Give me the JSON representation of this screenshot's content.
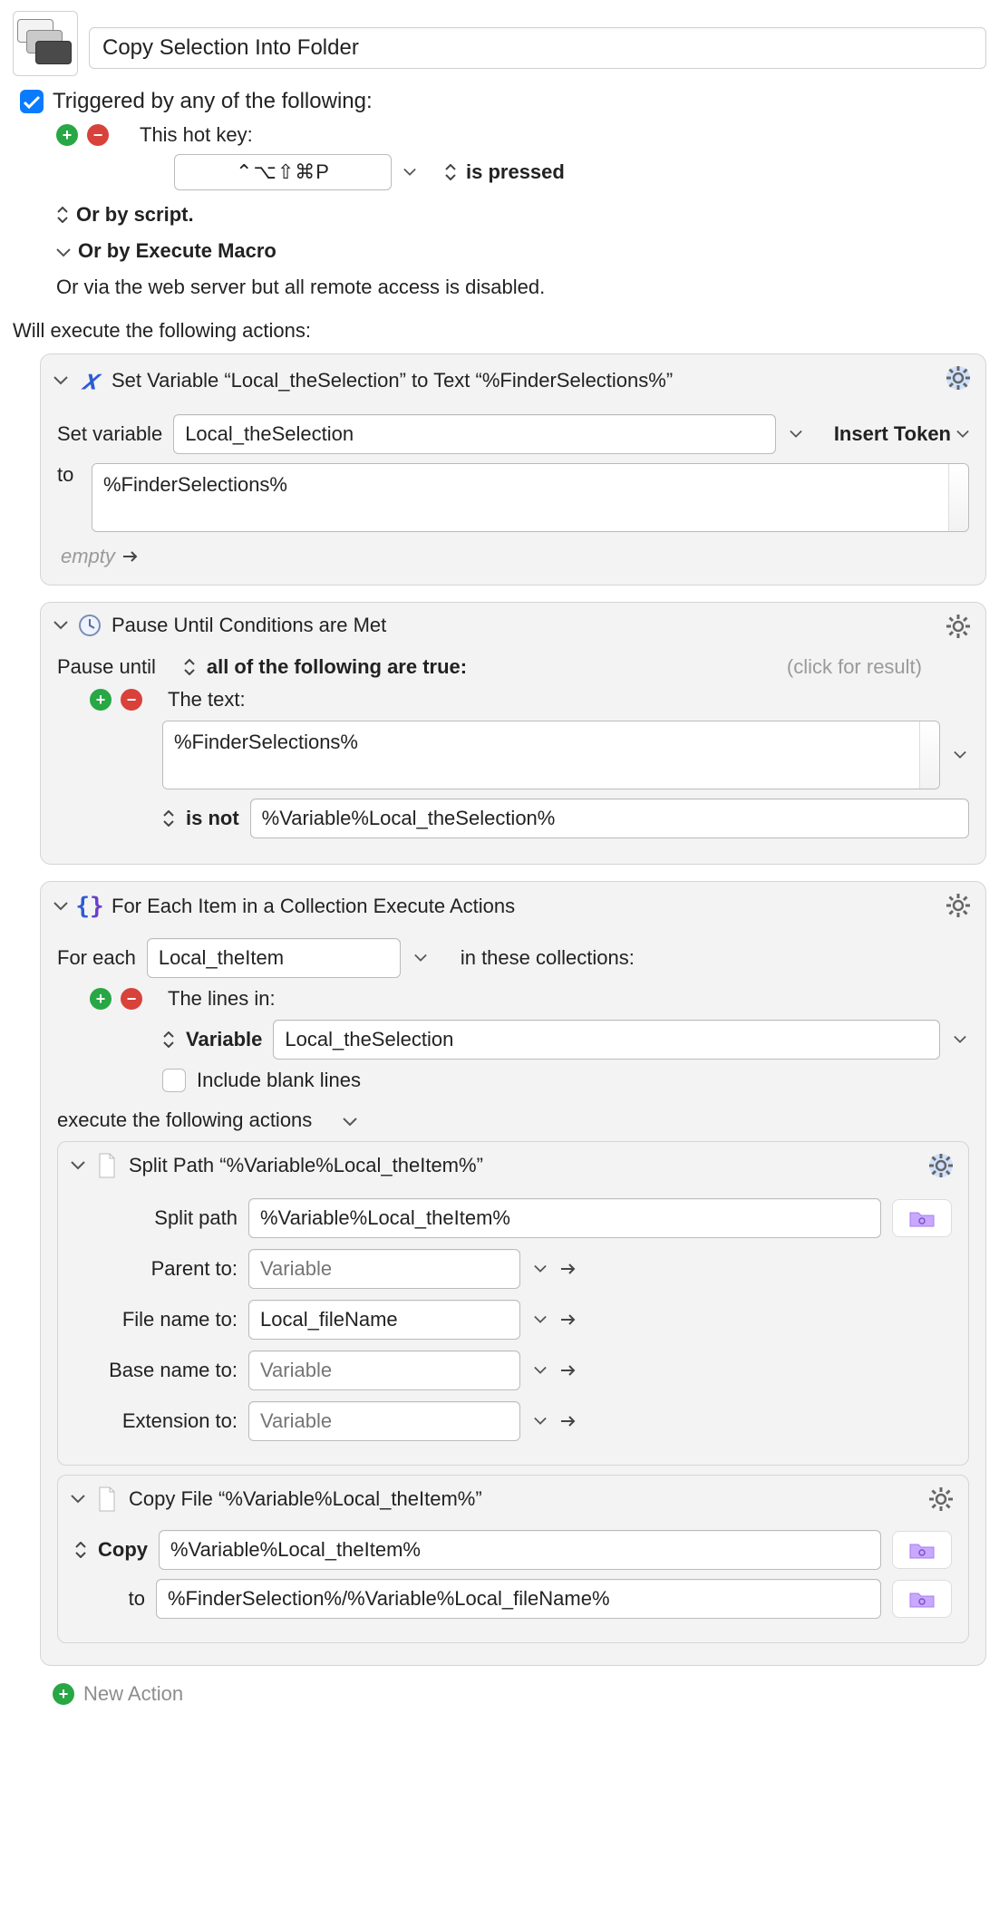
{
  "macro": {
    "title": "Copy Selection Into Folder",
    "triggered_label": "Triggered by any of the following:",
    "hotkey_label": "This hot key:",
    "hotkey_value": "⌃⌥⇧⌘P",
    "is_pressed": "is pressed",
    "or_script": "Or by script.",
    "or_execute_macro": "Or by Execute Macro",
    "or_web": "Or via the web server but all remote access is disabled.",
    "will_execute": "Will execute the following actions:"
  },
  "action1": {
    "title": "Set Variable “Local_theSelection” to Text “%FinderSelections%”",
    "set_variable_label": "Set variable",
    "variable_name": "Local_theSelection",
    "insert_token": "Insert Token",
    "to_label": "to",
    "to_value": "%FinderSelections%",
    "empty_hint": "empty"
  },
  "action2": {
    "title": "Pause Until Conditions are Met",
    "pause_until": "Pause until",
    "all_true": "all of the following are true:",
    "click_result": "(click for result)",
    "the_text": "The text:",
    "text_value": "%FinderSelections%",
    "is_not": "is not",
    "compare_value": "%Variable%Local_theSelection%"
  },
  "action3": {
    "title": "For Each Item in a Collection Execute Actions",
    "for_each": "For each",
    "item_var": "Local_theItem",
    "in_these": "in these collections:",
    "lines_in": "The lines in:",
    "variable_label": "Variable",
    "variable_value": "Local_theSelection",
    "include_blank": "Include blank lines",
    "execute_following": "execute the following actions"
  },
  "action3a": {
    "title": "Split Path “%Variable%Local_theItem%”",
    "split_path_label": "Split path",
    "split_path_value": "%Variable%Local_theItem%",
    "parent_label": "Parent to:",
    "filename_label": "File name to:",
    "filename_value": "Local_fileName",
    "basename_label": "Base name to:",
    "extension_label": "Extension to:",
    "var_placeholder": "Variable"
  },
  "action3b": {
    "title": "Copy File “%Variable%Local_theItem%”",
    "copy_label": "Copy",
    "copy_value": "%Variable%Local_theItem%",
    "to_label": "to",
    "to_value": "%FinderSelection%/%Variable%Local_fileName%"
  },
  "footer": {
    "new_action": "New Action"
  }
}
